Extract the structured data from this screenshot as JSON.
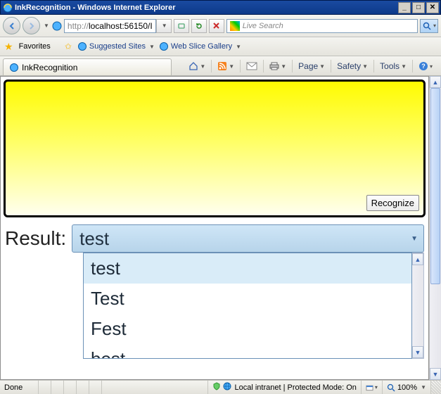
{
  "window": {
    "title": "InkRecognition - Windows Internet Explorer"
  },
  "address": {
    "scheme": "http://",
    "hostpath": "localhost:56150/I"
  },
  "search": {
    "placeholder": "Live Search"
  },
  "favbar": {
    "label": "Favorites",
    "suggested": "Suggested Sites",
    "webslice": "Web Slice Gallery"
  },
  "tab": {
    "title": "InkRecognition"
  },
  "command_bar": {
    "page": "Page",
    "safety": "Safety",
    "tools": "Tools"
  },
  "page": {
    "recognize_btn": "Recognize",
    "result_label": "Result:",
    "combo_value": "test",
    "options": [
      "test",
      "Test",
      "Fest",
      "best"
    ]
  },
  "status": {
    "done": "Done",
    "zone": "Local intranet | Protected Mode: On",
    "zoom": "100%"
  }
}
